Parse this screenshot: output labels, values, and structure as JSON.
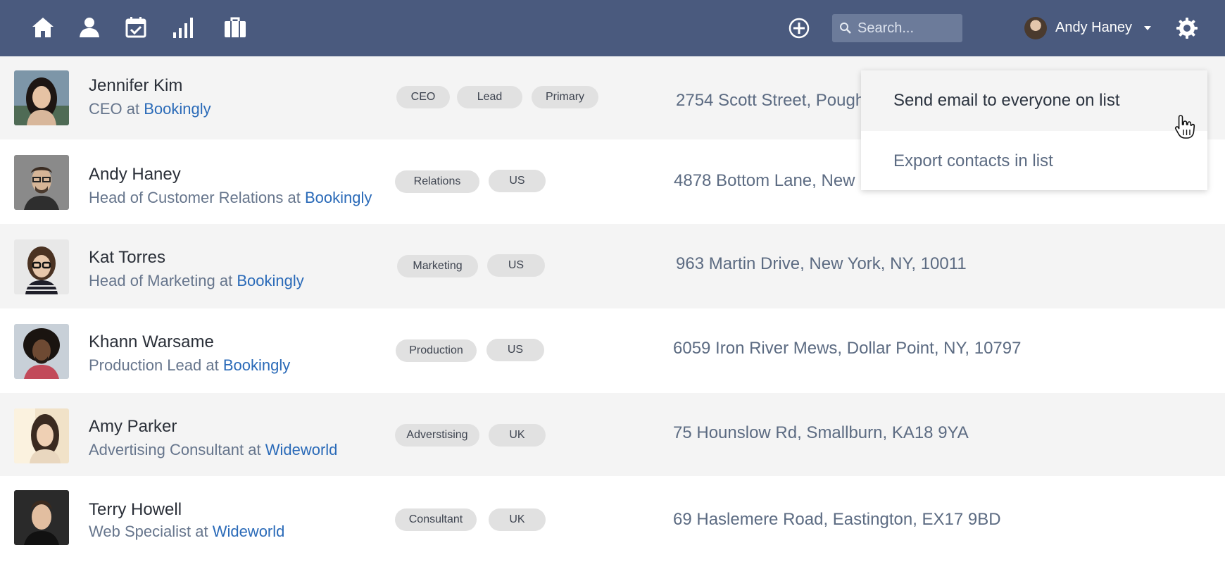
{
  "nav": {
    "icons": [
      "home-icon",
      "person-icon",
      "calendar-check-icon",
      "bar-chart-icon",
      "briefcase-icon"
    ],
    "add_icon": "plus-circle-icon",
    "search": {
      "placeholder": "Search..."
    },
    "user": {
      "name": "Andy Haney"
    },
    "settings_icon": "gear-icon"
  },
  "contacts": [
    {
      "name": "Jennifer Kim",
      "role": "CEO at ",
      "company": "Bookingly",
      "tags": [
        "CEO",
        "Lead",
        "Primary"
      ],
      "address": "2754 Scott Street, Pough"
    },
    {
      "name": "Andy Haney",
      "role": "Head of Customer Relations at ",
      "company": "Bookingly",
      "tags": [
        "Relations",
        "US"
      ],
      "address": "4878 Bottom Lane, New"
    },
    {
      "name": "Kat Torres",
      "role": "Head of Marketing at ",
      "company": "Bookingly",
      "tags": [
        "Marketing",
        "US"
      ],
      "address": "963 Martin Drive, New York, NY, 10011"
    },
    {
      "name": "Khann Warsame",
      "role": "Production Lead at ",
      "company": "Bookingly",
      "tags": [
        "Production",
        "US"
      ],
      "address": "6059 Iron River Mews, Dollar Point, NY, 10797"
    },
    {
      "name": "Amy Parker",
      "role": "Advertising Consultant at ",
      "company": "Wideworld",
      "tags": [
        "Adverstising",
        "UK"
      ],
      "address": "75 Hounslow Rd, Smallburn, KA18 9YA"
    },
    {
      "name": "Terry Howell",
      "role": "Web Specialist at ",
      "company": "Wideworld",
      "tags": [
        "Consultant",
        "UK"
      ],
      "address": "69 Haslemere Road, Eastington, EX17 9BD"
    }
  ],
  "dropdown": {
    "items": [
      "Send email to everyone on list",
      "Export contacts in list"
    ]
  },
  "colors": {
    "navbar": "#4a5a7e",
    "link": "#2a6ab8",
    "row_alt": "#f4f4f4",
    "tag": "#e1e1e1"
  }
}
